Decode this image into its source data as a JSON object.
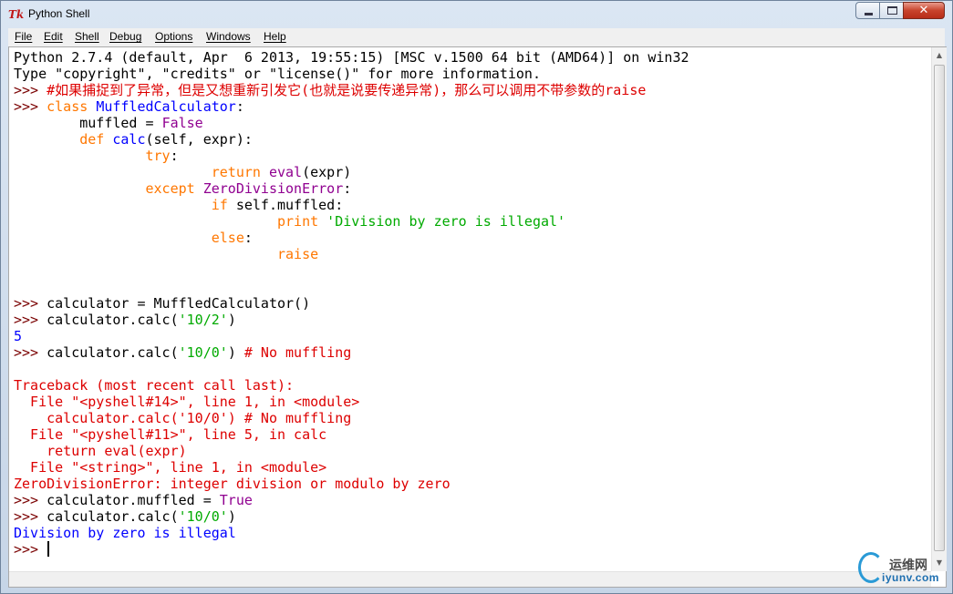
{
  "window": {
    "title": "Python Shell",
    "icon": "tk-feather-icon",
    "controls": {
      "minimize": "minimize-icon",
      "maximize": "maximize-icon",
      "close": "✕"
    }
  },
  "menu": [
    "File",
    "Edit",
    "Shell",
    "Debug",
    "Options",
    "Windows",
    "Help"
  ],
  "lines": [
    [
      {
        "t": "Python 2.7.4 (default, Apr  6 2013, 19:55:15) [MSC v.1500 64 bit (AMD64)] on win32",
        "c": "n"
      }
    ],
    [
      {
        "t": "Type \"copyright\", \"credits\" or \"license()\" for more information.",
        "c": "n"
      }
    ],
    [
      {
        "t": ">>> ",
        "c": "p"
      },
      {
        "t": "#如果捕捉到了异常，但是又想重新引发它(也就是说要传递异常)，那么可以调用不带参数的raise",
        "c": "c"
      }
    ],
    [
      {
        "t": ">>> ",
        "c": "p"
      },
      {
        "t": "class",
        "c": "k"
      },
      {
        "t": " ",
        "c": "n"
      },
      {
        "t": "MuffledCalculator",
        "c": "f"
      },
      {
        "t": ":",
        "c": "n"
      }
    ],
    [
      {
        "t": "        muffled = ",
        "c": "n"
      },
      {
        "t": "False",
        "c": "d"
      }
    ],
    [
      {
        "t": "        ",
        "c": "n"
      },
      {
        "t": "def",
        "c": "k"
      },
      {
        "t": " ",
        "c": "n"
      },
      {
        "t": "calc",
        "c": "f"
      },
      {
        "t": "(self, expr):",
        "c": "n"
      }
    ],
    [
      {
        "t": "                ",
        "c": "n"
      },
      {
        "t": "try",
        "c": "k"
      },
      {
        "t": ":",
        "c": "n"
      }
    ],
    [
      {
        "t": "                        ",
        "c": "n"
      },
      {
        "t": "return",
        "c": "k"
      },
      {
        "t": " ",
        "c": "n"
      },
      {
        "t": "eval",
        "c": "d"
      },
      {
        "t": "(expr)",
        "c": "n"
      }
    ],
    [
      {
        "t": "                ",
        "c": "n"
      },
      {
        "t": "except",
        "c": "k"
      },
      {
        "t": " ",
        "c": "n"
      },
      {
        "t": "ZeroDivisionError",
        "c": "d"
      },
      {
        "t": ":",
        "c": "n"
      }
    ],
    [
      {
        "t": "                        ",
        "c": "n"
      },
      {
        "t": "if",
        "c": "k"
      },
      {
        "t": " self.muffled:",
        "c": "n"
      }
    ],
    [
      {
        "t": "                                ",
        "c": "n"
      },
      {
        "t": "print",
        "c": "k"
      },
      {
        "t": " ",
        "c": "n"
      },
      {
        "t": "'Division by zero is illegal'",
        "c": "s"
      }
    ],
    [
      {
        "t": "                        ",
        "c": "n"
      },
      {
        "t": "else",
        "c": "k"
      },
      {
        "t": ":",
        "c": "n"
      }
    ],
    [
      {
        "t": "                                ",
        "c": "n"
      },
      {
        "t": "raise",
        "c": "k"
      }
    ],
    [
      {
        "t": "",
        "c": "n"
      }
    ],
    [
      {
        "t": "",
        "c": "n"
      }
    ],
    [
      {
        "t": ">>> ",
        "c": "p"
      },
      {
        "t": "calculator = MuffledCalculator()",
        "c": "n"
      }
    ],
    [
      {
        "t": ">>> ",
        "c": "p"
      },
      {
        "t": "calculator.calc(",
        "c": "n"
      },
      {
        "t": "'10/2'",
        "c": "s"
      },
      {
        "t": ")",
        "c": "n"
      }
    ],
    [
      {
        "t": "5",
        "c": "o"
      }
    ],
    [
      {
        "t": ">>> ",
        "c": "p"
      },
      {
        "t": "calculator.calc(",
        "c": "n"
      },
      {
        "t": "'10/0'",
        "c": "s"
      },
      {
        "t": ") ",
        "c": "n"
      },
      {
        "t": "# No muffling",
        "c": "h"
      }
    ],
    [
      {
        "t": "",
        "c": "n"
      }
    ],
    [
      {
        "t": "Traceback (most recent call last):",
        "c": "e"
      }
    ],
    [
      {
        "t": "  File \"<pyshell#14>\", line 1, in <module>",
        "c": "e"
      }
    ],
    [
      {
        "t": "    calculator.calc('10/0') # No muffling",
        "c": "e"
      }
    ],
    [
      {
        "t": "  File \"<pyshell#11>\", line 5, in calc",
        "c": "e"
      }
    ],
    [
      {
        "t": "    return eval(expr)",
        "c": "e"
      }
    ],
    [
      {
        "t": "  File \"<string>\", line 1, in <module>",
        "c": "e"
      }
    ],
    [
      {
        "t": "ZeroDivisionError: integer division or modulo by zero",
        "c": "e"
      }
    ],
    [
      {
        "t": ">>> ",
        "c": "p"
      },
      {
        "t": "calculator.muffled = ",
        "c": "n"
      },
      {
        "t": "True",
        "c": "d"
      }
    ],
    [
      {
        "t": ">>> ",
        "c": "p"
      },
      {
        "t": "calculator.calc(",
        "c": "n"
      },
      {
        "t": "'10/0'",
        "c": "s"
      },
      {
        "t": ")",
        "c": "n"
      }
    ],
    [
      {
        "t": "Division by zero is illegal",
        "c": "o"
      }
    ],
    [
      {
        "t": ">>> ",
        "c": "p"
      }
    ]
  ],
  "colors": {
    "keyword": "#ff7700",
    "builtin": "#900090",
    "definition": "#0000ff",
    "string": "#00aa00",
    "comment": "#dd0000",
    "prompt": "#7a0000",
    "stdout": "#0000ff",
    "stderr": "#dd0000"
  },
  "watermark": {
    "name": "运维网",
    "url": "iyunv.com"
  }
}
